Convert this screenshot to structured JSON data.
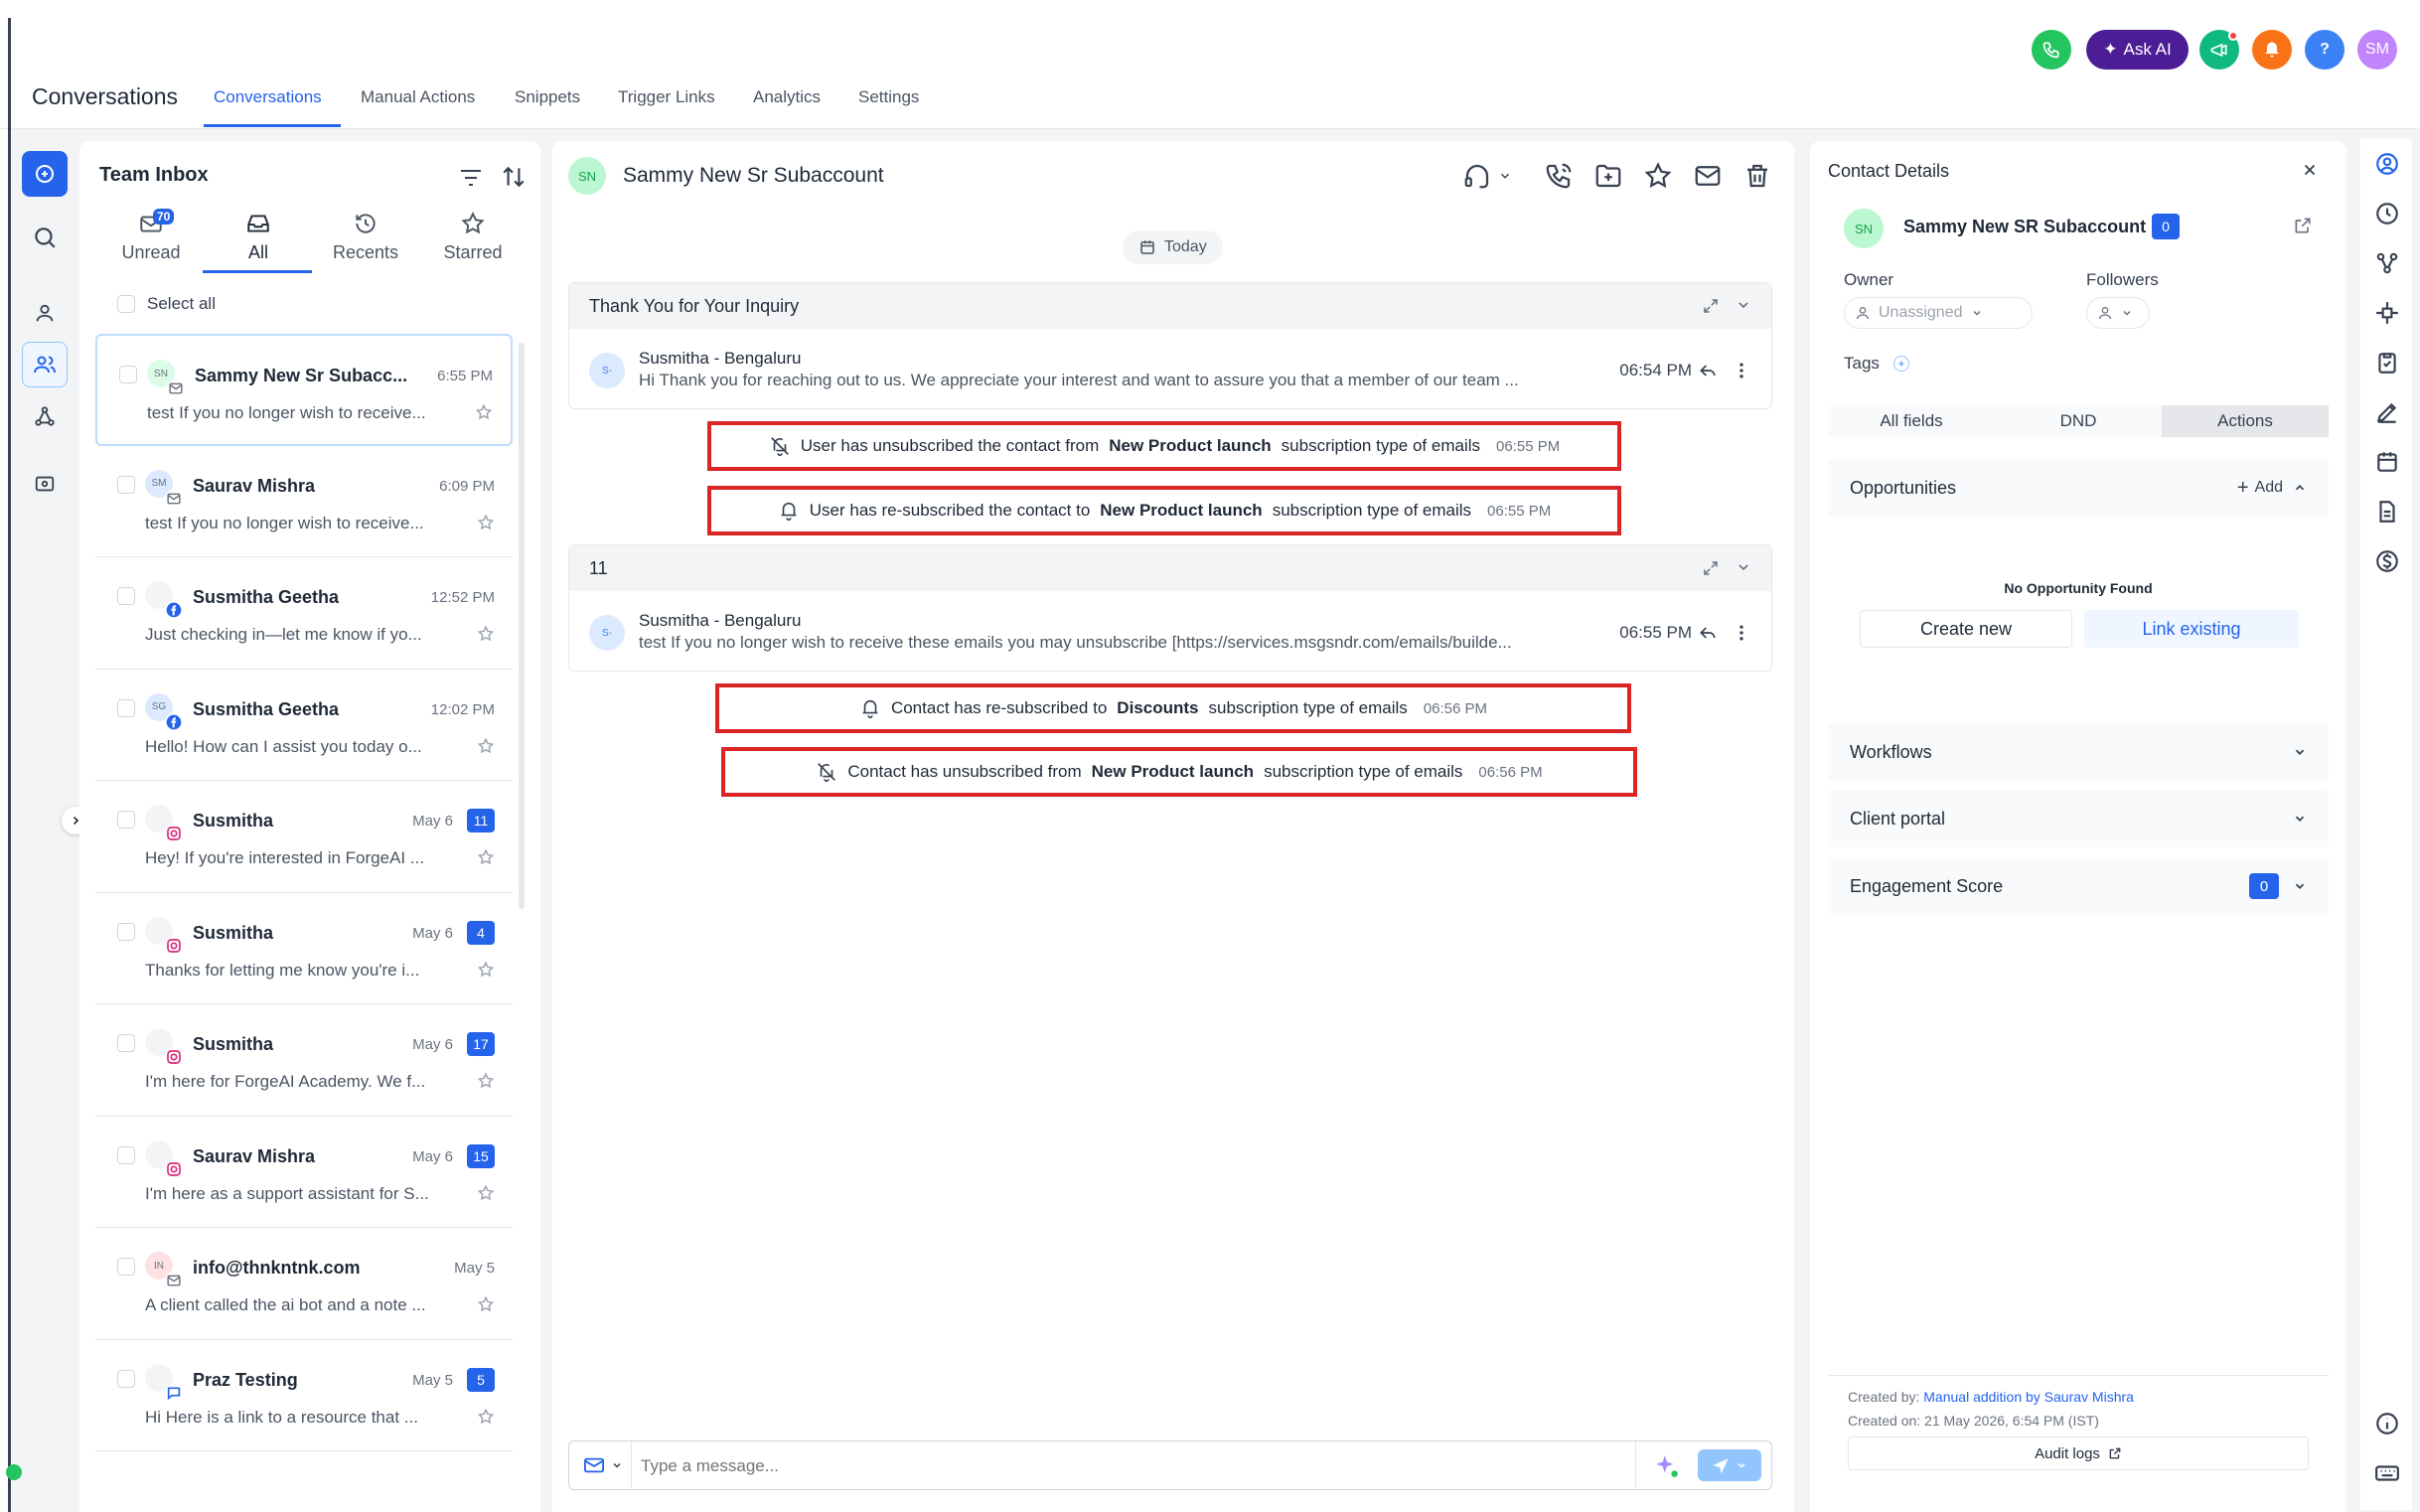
{
  "header": {
    "app_title": "Conversations",
    "tabs": [
      {
        "label": "Conversations",
        "active": true
      },
      {
        "label": "Manual Actions"
      },
      {
        "label": "Snippets"
      },
      {
        "label": "Trigger Links"
      },
      {
        "label": "Analytics"
      },
      {
        "label": "Settings"
      }
    ],
    "ask_ai_label": "Ask AI",
    "help_label": "?",
    "user_initials": "SM",
    "colors": {
      "phone": "#22c55e",
      "ask_ai": "#4c1d95",
      "announce": "#10b981",
      "notify": "#f97316",
      "help": "#3b82f6",
      "avatar": "#c084fc"
    }
  },
  "inbox": {
    "title": "Team Inbox",
    "tabs": [
      {
        "label": "Unread",
        "badge": "70",
        "icon": "mail-icon"
      },
      {
        "label": "All",
        "icon": "inbox-icon",
        "active": true
      },
      {
        "label": "Recents",
        "icon": "history-icon"
      },
      {
        "label": "Starred",
        "icon": "star-icon"
      }
    ],
    "select_all": "Select all",
    "conversations": [
      {
        "name": "Sammy New Sr Subacc...",
        "initials": "SN",
        "time": "6:55 PM",
        "preview": "test If you no longer wish to receive...",
        "channel": "email",
        "selected": true
      },
      {
        "name": "Saurav Mishra",
        "initials": "SM",
        "time": "6:09 PM",
        "preview": "test If you no longer wish to receive...",
        "channel": "email"
      },
      {
        "name": "Susmitha Geetha",
        "initials": "",
        "time": "12:52 PM",
        "preview": "Just checking in—let me know if yo...",
        "channel": "facebook"
      },
      {
        "name": "Susmitha Geetha",
        "initials": "SG",
        "time": "12:02 PM",
        "preview": "Hello! How can I assist you today o...",
        "channel": "facebook"
      },
      {
        "name": "Susmitha",
        "initials": "",
        "time": "May 6",
        "count": "11",
        "preview": "Hey! If you're interested in ForgeAI ...",
        "channel": "instagram"
      },
      {
        "name": "Susmitha",
        "initials": "",
        "time": "May 6",
        "count": "4",
        "preview": "Thanks for letting me know you're i...",
        "channel": "instagram"
      },
      {
        "name": "Susmitha",
        "initials": "",
        "time": "May 6",
        "count": "17",
        "preview": "I'm here for ForgeAI Academy. We f...",
        "channel": "instagram"
      },
      {
        "name": "Saurav Mishra",
        "initials": "",
        "time": "May 6",
        "count": "15",
        "preview": "I'm here as a support assistant for S...",
        "channel": "instagram"
      },
      {
        "name": "info@thnkntnk.com",
        "initials": "IN",
        "time": "May 5",
        "preview": "A client called the ai bot and a note ...",
        "channel": "email"
      },
      {
        "name": "Praz Testing",
        "initials": "",
        "time": "May 5",
        "count": "5",
        "preview": "Hi Here is a link to a resource that ...",
        "channel": "chat"
      }
    ]
  },
  "chat": {
    "contact_initials": "SN",
    "contact_name": "Sammy New Sr Subaccount",
    "date_label": "Today",
    "threads": [
      {
        "subject": "Thank You for Your Inquiry",
        "from": "Susmitha - Bengaluru",
        "initials": "S-",
        "body": "Hi Thank you for reaching out to us. We appreciate your interest and want to assure you that a member of our team ...",
        "time": "06:54 PM"
      },
      {
        "subject": "11",
        "from": "Susmitha - Bengaluru",
        "initials": "S-",
        "body": "test If you no longer wish to receive these emails you may unsubscribe [https://services.msgsndr.com/emails/builde...",
        "time": "06:55 PM"
      }
    ],
    "events": [
      {
        "pre": "User has unsubscribed the contact from",
        "bold": "New Product launch",
        "post": "subscription type of emails",
        "time": "06:55 PM",
        "icon": "bell-off-icon"
      },
      {
        "pre": "User has re-subscribed the contact to",
        "bold": "New Product launch",
        "post": "subscription type of emails",
        "time": "06:55 PM",
        "icon": "bell-icon"
      },
      {
        "pre": "Contact has re-subscribed to",
        "bold": "Discounts",
        "post": "subscription type of emails",
        "time": "06:56 PM",
        "icon": "bell-icon"
      },
      {
        "pre": "Contact has unsubscribed from",
        "bold": "New Product launch",
        "post": "subscription type of emails",
        "time": "06:56 PM",
        "icon": "bell-off-icon"
      }
    ],
    "composer_placeholder": "Type a message..."
  },
  "contact": {
    "title": "Contact Details",
    "initials": "SN",
    "name": "Sammy New SR Subaccount",
    "name_badge": "0",
    "owner_label": "Owner",
    "owner_value": "Unassigned",
    "followers_label": "Followers",
    "tags_label": "Tags",
    "tabs": [
      "All fields",
      "DND",
      "Actions"
    ],
    "active_tab": "Actions",
    "opportunities": {
      "title": "Opportunities",
      "add_label": "Add",
      "empty": "No Opportunity Found",
      "create": "Create new",
      "link": "Link existing"
    },
    "workflows": "Workflows",
    "client_portal": "Client portal",
    "engagement": {
      "title": "Engagement Score",
      "value": "0"
    },
    "created_by_label": "Created by:",
    "created_by_value": "Manual addition by Saurav Mishra",
    "created_on": "Created on: 21 May 2026, 6:54 PM (IST)",
    "audit_logs": "Audit logs"
  }
}
